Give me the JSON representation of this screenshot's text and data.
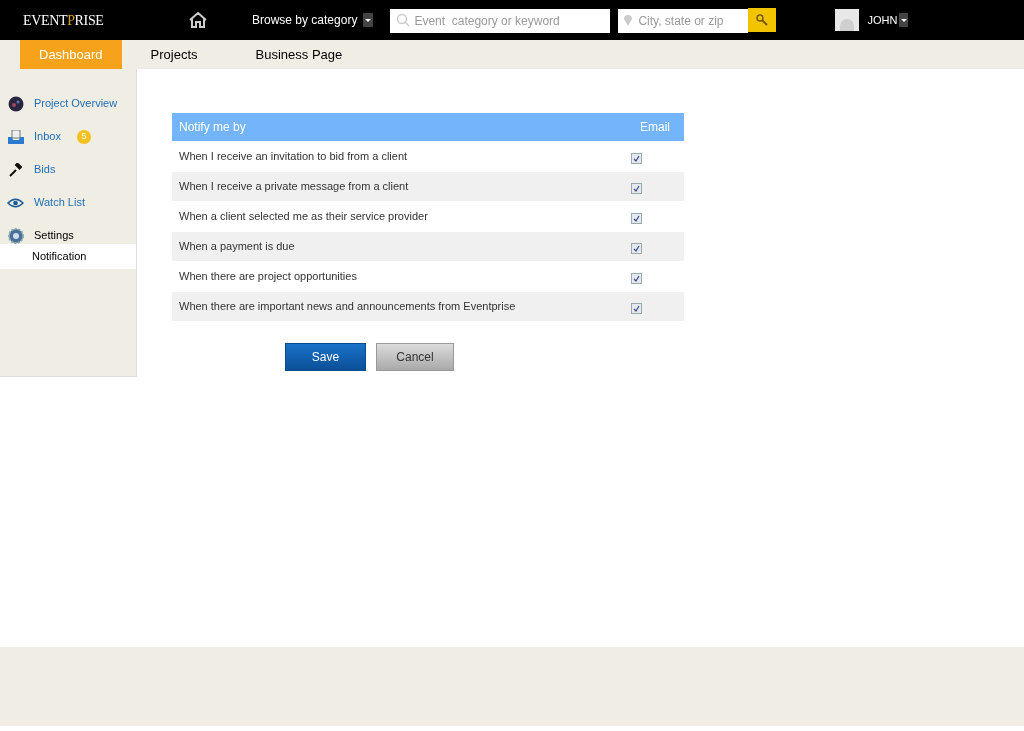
{
  "header": {
    "logo": {
      "start": "EVENT",
      "accent": "P",
      "end": "RISE"
    },
    "browse": "Browse by category",
    "search": {
      "placeholder": "Event  category or keyword"
    },
    "location": {
      "placeholder": "City, state or zip"
    },
    "user": "JOHN"
  },
  "nav": [
    {
      "label": "Dashboard",
      "selected": true
    },
    {
      "label": "Projects",
      "selected": false
    },
    {
      "label": "Business Page",
      "selected": false
    }
  ],
  "sidebar": [
    {
      "kind": "overview",
      "label": "Project Overview",
      "selected": false
    },
    {
      "kind": "inbox",
      "label": "Inbox",
      "badge": "5",
      "selected": false
    },
    {
      "kind": "bids",
      "label": "Bids",
      "selected": false
    },
    {
      "kind": "watch",
      "label": "Watch List",
      "selected": false
    },
    {
      "kind": "settings",
      "label": "Settings",
      "selected": true,
      "children": [
        {
          "label": "Notification",
          "selected": true
        }
      ]
    }
  ],
  "table": {
    "columns": [
      "Notify me by",
      "Email"
    ],
    "rows": [
      {
        "label": "When I receive an invitation to bid from a client",
        "checked": true
      },
      {
        "label": "When I receive a private message from a client",
        "checked": true
      },
      {
        "label": "When a client selected me as their service provider",
        "checked": true
      },
      {
        "label": "When a payment is due",
        "checked": true
      },
      {
        "label": "When there are project opportunities",
        "checked": true
      },
      {
        "label": "When there are important news and announcements from Eventprise",
        "checked": true
      }
    ]
  },
  "buttons": [
    {
      "kind": "primary",
      "label": "Save"
    },
    {
      "kind": "secondary",
      "label": "Cancel"
    }
  ]
}
